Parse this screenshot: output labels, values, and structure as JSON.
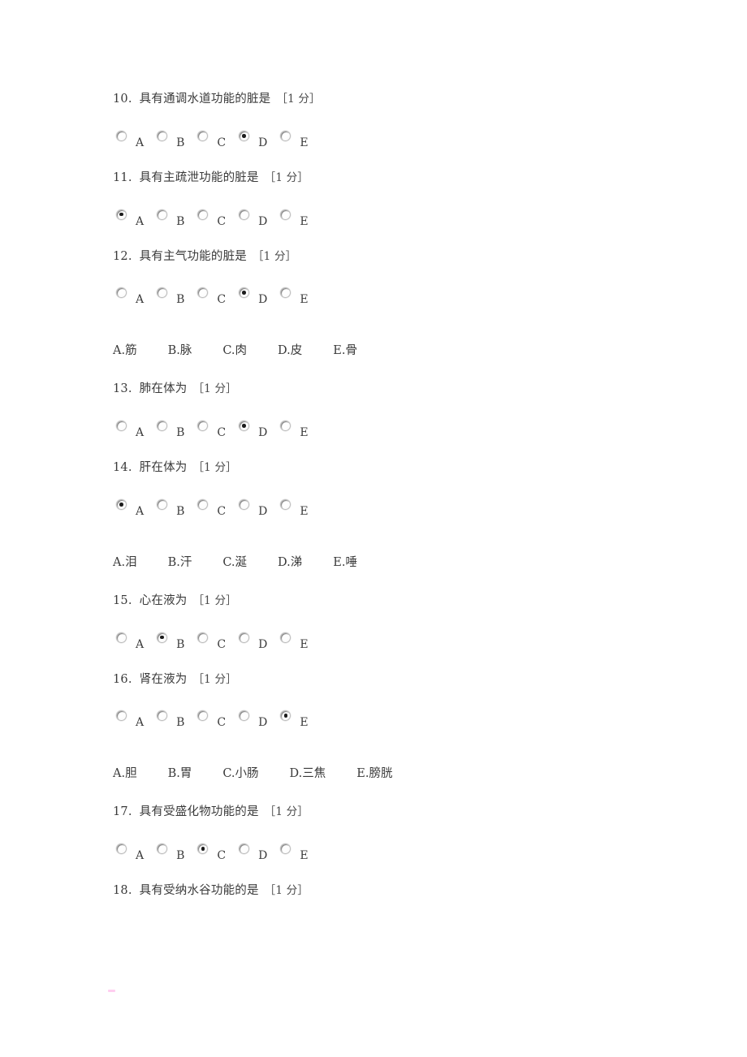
{
  "document": {
    "language": "zh-CN",
    "page_background": "#ffffff",
    "text_color": "#3a3a3a",
    "points_suffix": "［1 分］"
  },
  "blocks": [
    {
      "id": "block-1",
      "option_bank": null,
      "questions": [
        {
          "number": "10.",
          "text": "具有通调水道功能的脏是",
          "points": "［1 分］",
          "options": [
            "A",
            "B",
            "C",
            "D",
            "E"
          ],
          "selected_index": 3
        },
        {
          "number": "11.",
          "text": "具有主疏泄功能的脏是",
          "points": "［1 分］",
          "options": [
            "A",
            "B",
            "C",
            "D",
            "E"
          ],
          "selected_index": 0
        },
        {
          "number": "12.",
          "text": "具有主气功能的脏是",
          "points": "［1 分］",
          "options": [
            "A",
            "B",
            "C",
            "D",
            "E"
          ],
          "selected_index": 3
        }
      ]
    },
    {
      "id": "block-2",
      "option_bank": [
        {
          "key": "A.",
          "value": "筋"
        },
        {
          "key": "B.",
          "value": "脉"
        },
        {
          "key": "C.",
          "value": "肉"
        },
        {
          "key": "D.",
          "value": "皮"
        },
        {
          "key": "E.",
          "value": "骨"
        }
      ],
      "questions": [
        {
          "number": "13.",
          "text": "肺在体为",
          "points": "［1 分］",
          "options": [
            "A",
            "B",
            "C",
            "D",
            "E"
          ],
          "selected_index": 3
        },
        {
          "number": "14.",
          "text": "肝在体为",
          "points": "［1 分］",
          "options": [
            "A",
            "B",
            "C",
            "D",
            "E"
          ],
          "selected_index": 0
        }
      ]
    },
    {
      "id": "block-3",
      "option_bank": [
        {
          "key": "A.",
          "value": "泪"
        },
        {
          "key": "B.",
          "value": "汗"
        },
        {
          "key": "C.",
          "value": "涎"
        },
        {
          "key": "D.",
          "value": "涕"
        },
        {
          "key": "E.",
          "value": "唾"
        }
      ],
      "questions": [
        {
          "number": "15.",
          "text": "心在液为",
          "points": "［1 分］",
          "options": [
            "A",
            "B",
            "C",
            "D",
            "E"
          ],
          "selected_index": 1
        },
        {
          "number": "16.",
          "text": "肾在液为",
          "points": "［1 分］",
          "options": [
            "A",
            "B",
            "C",
            "D",
            "E"
          ],
          "selected_index": 4
        }
      ]
    },
    {
      "id": "block-4",
      "option_bank": [
        {
          "key": "A.",
          "value": "胆"
        },
        {
          "key": "B.",
          "value": "胃"
        },
        {
          "key": "C.",
          "value": "小肠"
        },
        {
          "key": "D.",
          "value": "三焦"
        },
        {
          "key": "E.",
          "value": "膀胱"
        }
      ],
      "questions": [
        {
          "number": "17.",
          "text": "具有受盛化物功能的是",
          "points": "［1 分］",
          "options": [
            "A",
            "B",
            "C",
            "D",
            "E"
          ],
          "selected_index": 2
        },
        {
          "number": "18.",
          "text": "具有受纳水谷功能的是",
          "points": "［1 分］",
          "options": [],
          "selected_index": -1
        }
      ]
    }
  ]
}
